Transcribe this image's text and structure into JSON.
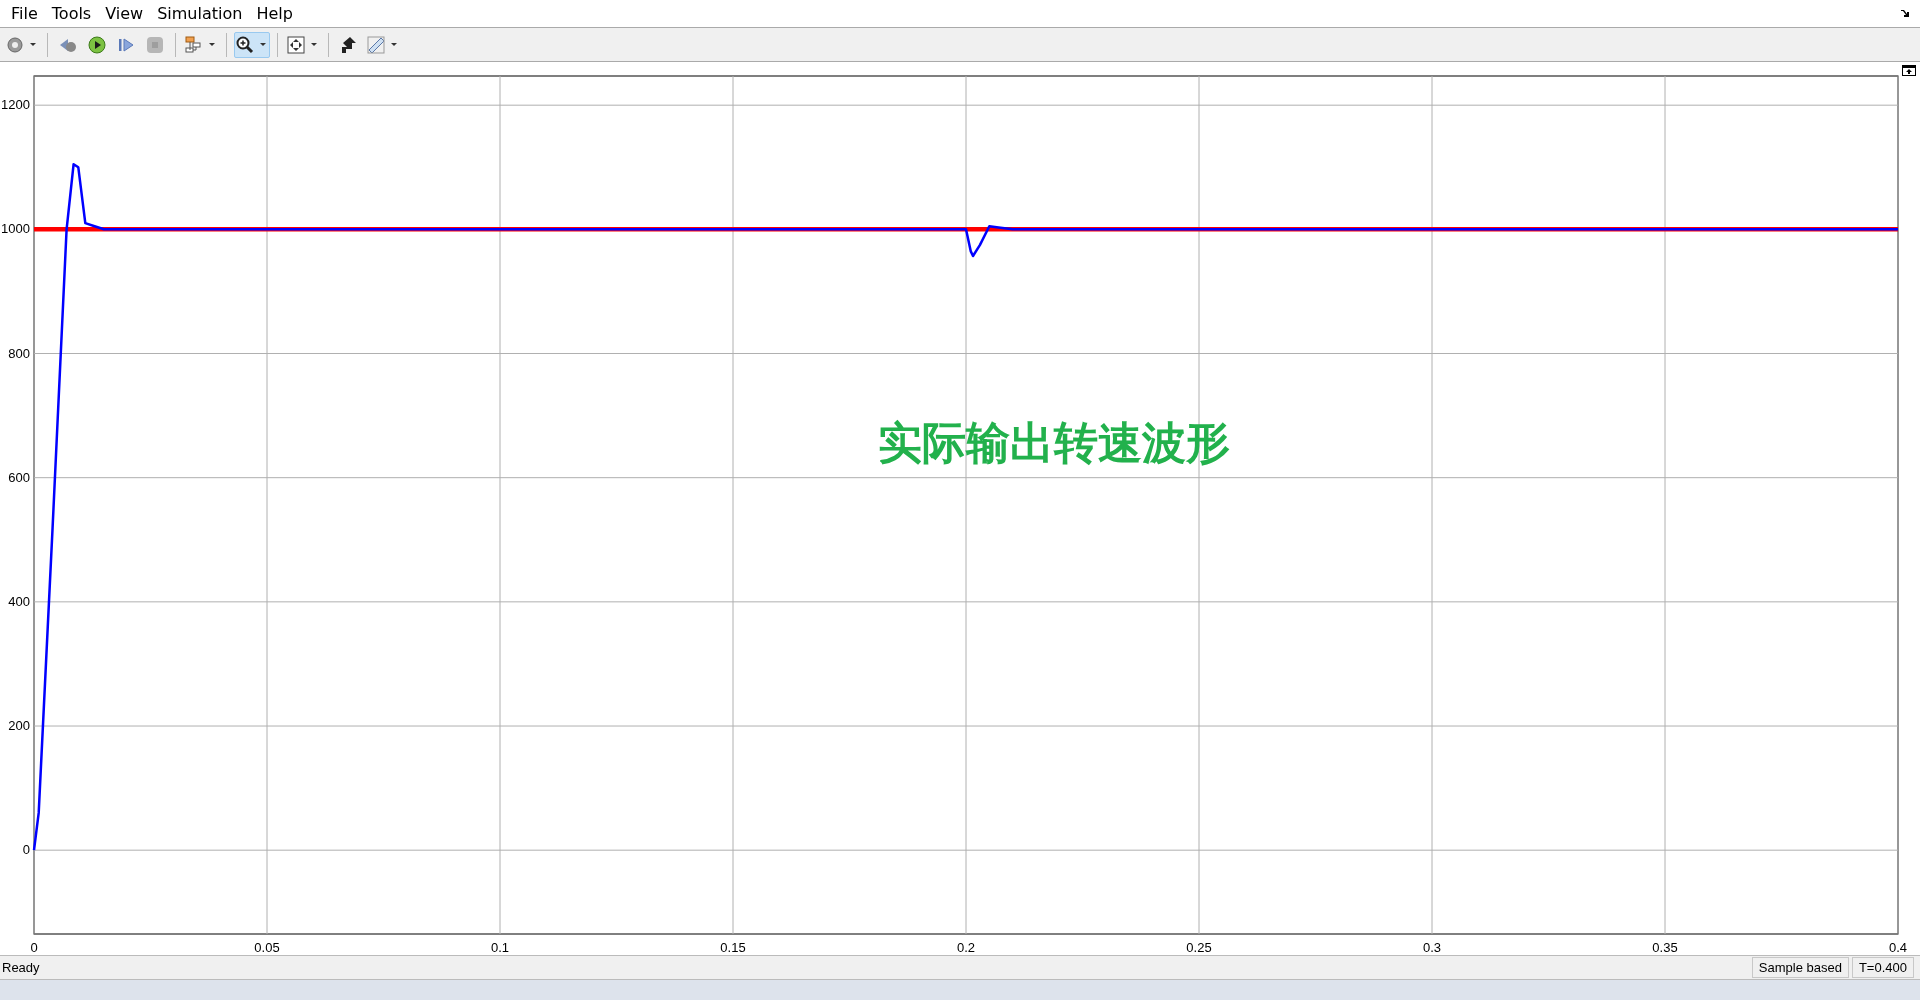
{
  "menu": [
    "File",
    "Tools",
    "View",
    "Simulation",
    "Help"
  ],
  "toolbar": {
    "groups": [
      [
        {
          "selected": false,
          "disabled": false,
          "dropdown": true
        }
      ],
      [
        {
          "selected": false,
          "disabled": false,
          "dropdown": false
        },
        {
          "selected": false,
          "disabled": false,
          "dropdown": false
        },
        {
          "selected": false,
          "disabled": false,
          "dropdown": false
        },
        {
          "selected": false,
          "disabled": true,
          "dropdown": false
        }
      ],
      [
        {
          "selected": false,
          "disabled": false,
          "dropdown": true
        }
      ],
      [
        {
          "selected": true,
          "disabled": false,
          "dropdown": true
        }
      ],
      [
        {
          "selected": false,
          "disabled": false,
          "dropdown": true
        }
      ],
      [
        {
          "selected": false,
          "disabled": false,
          "dropdown": false
        },
        {
          "selected": false,
          "disabled": false,
          "dropdown": true
        }
      ]
    ]
  },
  "plot": {
    "caption": "实际输出转速波形",
    "chart_data": {
      "type": "line",
      "x": [
        0,
        0.001,
        0.004,
        0.007,
        0.0085,
        0.0095,
        0.011,
        0.013,
        0.015,
        0.2,
        0.201,
        0.2015,
        0.203,
        0.205,
        0.207,
        0.21,
        0.4
      ],
      "series": [
        {
          "color": "#ff0000",
          "values": [
            1000,
            1000,
            1000,
            1000,
            1000,
            1000,
            1000,
            1000,
            1000,
            1000,
            1000,
            1000,
            1000,
            1000,
            1000,
            1000,
            1000
          ]
        },
        {
          "color": "#0000ff",
          "values": [
            0,
            60,
            520,
            1000,
            1105,
            1100,
            1010,
            1005,
            1000,
            1000,
            965,
            957,
            975,
            1005,
            1003,
            1000,
            1000
          ]
        }
      ],
      "xlim": [
        0,
        0.4
      ],
      "ylim": [
        -135,
        1247
      ],
      "xticks": [
        0,
        {
          "value": 0.05,
          "label": "0.05"
        },
        {
          "value": 0.1,
          "label": "0.1"
        },
        {
          "value": 0.15,
          "label": "0.15"
        },
        {
          "value": 0.2,
          "label": "0.2"
        },
        {
          "value": 0.25,
          "label": "0.25"
        },
        {
          "value": 0.3,
          "label": "0.3"
        },
        {
          "value": 0.35,
          "label": "0.35"
        },
        {
          "value": 0.4,
          "label": "0.4"
        }
      ],
      "yticks": [
        0,
        200,
        400,
        600,
        800,
        1000,
        1200
      ],
      "grid": true
    }
  },
  "status_bar": {
    "message": "Ready",
    "mode": "Sample based",
    "time": "T=0.400"
  }
}
